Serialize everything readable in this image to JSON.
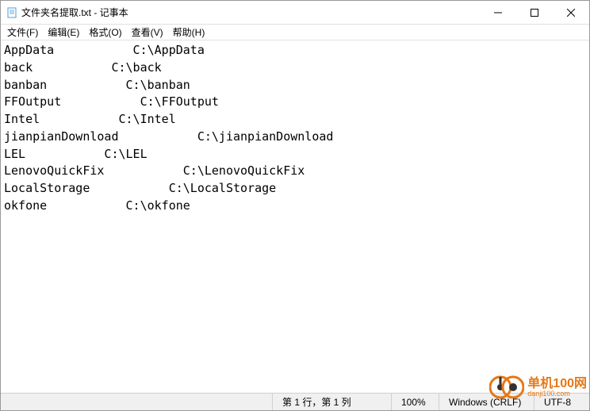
{
  "titlebar": {
    "title": "文件夹名提取.txt - 记事本"
  },
  "menu": {
    "file": "文件(F)",
    "edit": "编辑(E)",
    "format": "格式(O)",
    "view": "查看(V)",
    "help": "帮助(H)"
  },
  "content": "AppData           C:\\AppData\nback           C:\\back\nbanban           C:\\banban\nFFOutput           C:\\FFOutput\nIntel           C:\\Intel\njianpianDownload           C:\\jianpianDownload\nLEL           C:\\LEL\nLenovoQuickFix           C:\\LenovoQuickFix\nLocalStorage           C:\\LocalStorage\nokfone           C:\\okfone",
  "statusbar": {
    "position": "第 1 行，第 1 列",
    "zoom": "100%",
    "eol": "Windows (CRLF)",
    "encoding": "UTF-8"
  },
  "watermark": {
    "main": "单机100网",
    "sub": "danji100.com"
  }
}
